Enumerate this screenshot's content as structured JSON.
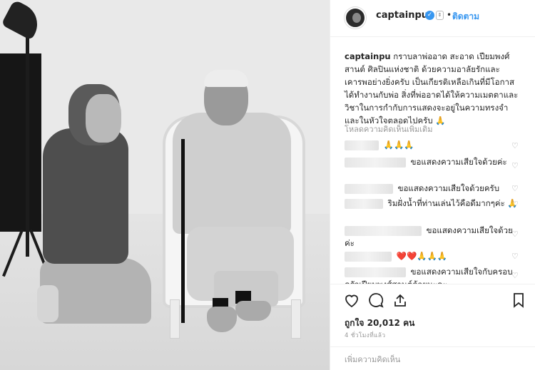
{
  "post": {
    "username": "captainpu",
    "verified_icon": "verified-badge-icon",
    "separator": "•",
    "follow_label": "ติดตาม"
  },
  "caption": {
    "username": "captainpu",
    "text": "กราบลาพ่ออาด สะอาด เปียมพงศ์สานต์ ศิลปินแห่งชาติ ด้วยความอาลัยรักและเคารพอย่างยิ่งครับ เป็นเกียรติเหลือเกินที่มีโอกาสได้ทำงานกับพ่อ สิ่งที่พ่ออาดได้ให้ความเมตตาและวิชาในการกำกับการแสดงจะอยู่ในความทรงจำและในหัวใจตลอดไปครับ 🙏"
  },
  "load_more_comments": "โหลดความคิดเห็นเพิ่มเติม",
  "comments": [
    {
      "text": "🙏🙏🙏"
    },
    {
      "text": "ขอแสดงความเสียใจด้วยค่ะ"
    },
    {
      "text": "ขอแสดงความเสียใจด้วยครับ"
    },
    {
      "text": "ริมฝั่งน้ำที่ท่านเล่นไว้คือดีมากๆค่ะ 🙏"
    },
    {
      "text": "ขอแสดงความเสียใจด้วยค่ะ"
    },
    {
      "text": "❤️❤️🙏🙏🙏"
    },
    {
      "text": "ขอแสดงความเสียใจกับครอบครัวเปียมพงศ์สานต์ด้วยนะคะ"
    }
  ],
  "likes_label": "ถูกใจ 20,012 คน",
  "time_label": "4 ชั่วโมงที่แล้ว",
  "add_comment_placeholder": "เพิ่มความคิดเห็น",
  "icons": {
    "like": "heart-icon",
    "comment": "comment-icon",
    "share": "share-icon",
    "save": "bookmark-icon"
  },
  "colors": {
    "link_blue": "#3897f0",
    "border": "#efefef",
    "muted": "#999999",
    "text": "#262626"
  }
}
